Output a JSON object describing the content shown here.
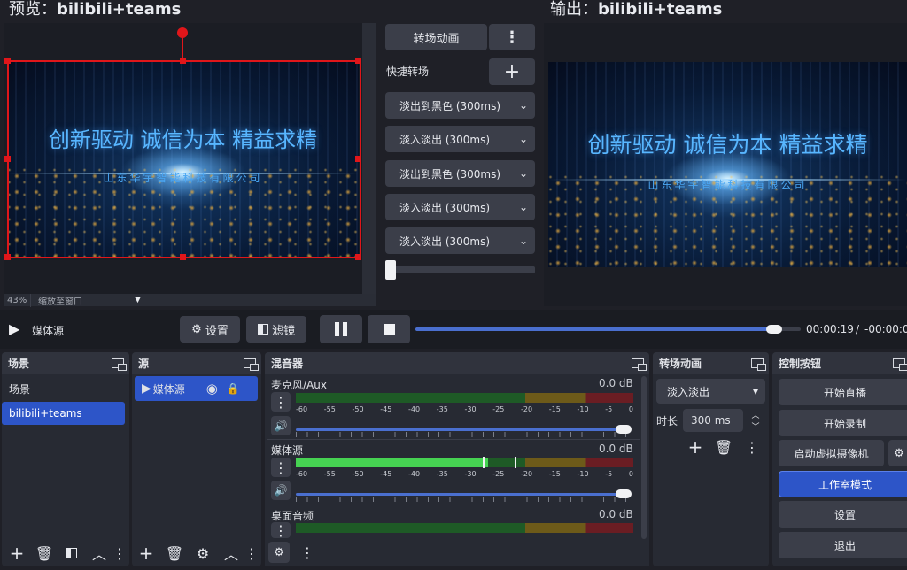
{
  "preview": {
    "prefix": "预览：",
    "title": "bilibili+teams",
    "zoom": "43%",
    "scale_mode": "缩放至窗口"
  },
  "output": {
    "prefix": "输出：",
    "title": "bilibili+teams"
  },
  "banner": {
    "line1": "创新驱动 诚信为本 精益求精",
    "line2": "山东华宇智能科技有限公司"
  },
  "transition_pane": {
    "transition_button": "转场动画",
    "quick_label": "快捷转场",
    "quick_items": [
      "淡出到黑色 (300ms)",
      "淡入淡出 (300ms)",
      "淡出到黑色 (300ms)",
      "淡入淡出 (300ms)",
      "淡入淡出 (300ms)"
    ]
  },
  "media_bar": {
    "source": "媒体源",
    "settings": "设置",
    "filters": "滤镜",
    "time": "00:00:19",
    "remaining": "-00:00:0",
    "progress": 0.93
  },
  "scenes": {
    "title": "场景",
    "items": [
      "场景",
      "bilibili+teams"
    ],
    "selected": 1
  },
  "sources": {
    "title": "源",
    "items": [
      "媒体源"
    ]
  },
  "mixer": {
    "title": "混音器",
    "scale": [
      "-60",
      "-55",
      "-50",
      "-45",
      "-40",
      "-35",
      "-30",
      "-25",
      "-20",
      "-15",
      "-10",
      "-5",
      "0"
    ],
    "channels": [
      {
        "name": "麦克风/Aux",
        "db": "0.0 dB",
        "level": 0.0,
        "volume": 1.0
      },
      {
        "name": "媒体源",
        "db": "0.0 dB",
        "level": 0.57,
        "volume": 1.0
      },
      {
        "name": "桌面音频",
        "db": "0.0 dB",
        "level": 0.0,
        "volume": 1.0
      }
    ]
  },
  "transitions": {
    "title": "转场动画",
    "selected": "淡入淡出",
    "duration_label": "时长",
    "duration": "300 ms"
  },
  "controls": {
    "title": "控制按钮",
    "buttons": [
      "开始直播",
      "开始录制",
      "启动虚拟摄像机",
      "工作室模式",
      "设置",
      "退出"
    ]
  },
  "colors": {
    "accent": "#2d55c8",
    "selection": "#e0161a",
    "meter_green": "#46d252"
  }
}
